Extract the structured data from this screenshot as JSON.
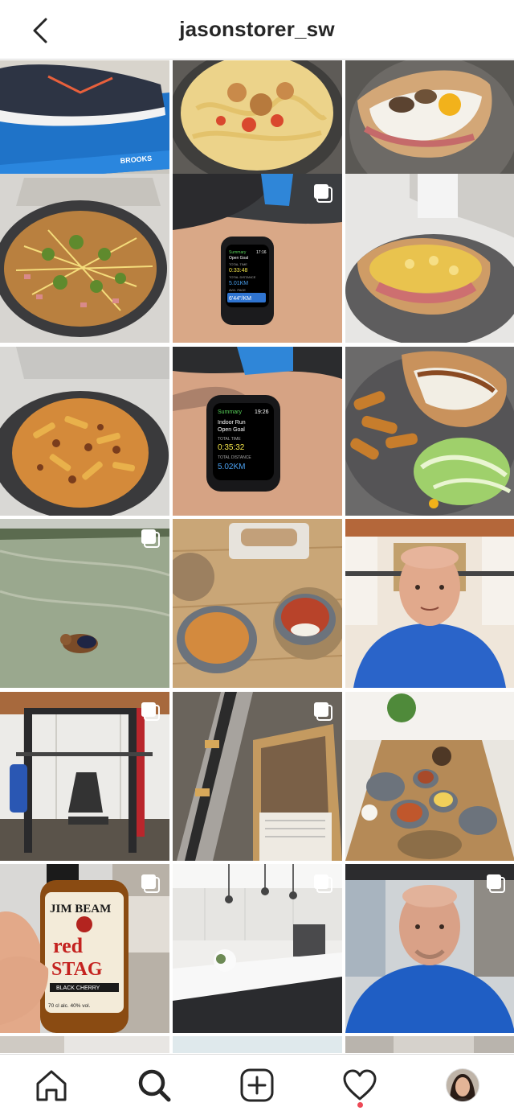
{
  "header": {
    "username": "jasonstorer_sw",
    "back_icon": "chevron-left-icon"
  },
  "grid": {
    "posts": [
      {
        "id": "shoes",
        "subject": "running shoes on box",
        "box_text": "BROOKS",
        "multi": false
      },
      {
        "id": "pasta-chicken",
        "subject": "tagliatelle with chicken",
        "multi": false
      },
      {
        "id": "pitta-mushroom",
        "subject": "pitta with egg and mushrooms",
        "multi": false
      },
      {
        "id": "loaded-fries",
        "subject": "loaded wedges with jalapenos",
        "multi": false
      },
      {
        "id": "watch-summary-1",
        "subject": "smartwatch workout summary",
        "multi": true,
        "watch": {
          "line1": "Summary",
          "line2": "Open Goal",
          "time": "17:16",
          "l3": "TOTAL TIME",
          "v3": "0:33:48",
          "l4": "TOTAL DISTANCE",
          "v4": "5.01KM",
          "l5": "AVG. PACE",
          "v5": "6'44\"/KM"
        }
      },
      {
        "id": "pitta-egg",
        "subject": "pitta with scrambled egg and bacon",
        "multi": false
      },
      {
        "id": "penne-bolognese",
        "subject": "penne bolognese",
        "multi": false
      },
      {
        "id": "watch-summary-2",
        "subject": "smartwatch indoor run",
        "multi": false,
        "watch": {
          "line1": "Summary",
          "time": "19:26",
          "line2": "Indoor Run",
          "line3": "Open Goal",
          "l4": "TOTAL TIME",
          "v4": "0:35:32",
          "l5": "TOTAL DISTANCE",
          "v5": "5.02KM"
        }
      },
      {
        "id": "pitta-wedges",
        "subject": "pitta with wedges and salad",
        "multi": false
      },
      {
        "id": "dog-field",
        "subject": "small dog on frosty field",
        "multi": true
      },
      {
        "id": "curry-table",
        "subject": "curry bowls on table",
        "multi": false
      },
      {
        "id": "selfie-1",
        "subject": "man in blue hoodie selfie",
        "multi": false
      },
      {
        "id": "home-gym",
        "subject": "home gym power rack",
        "multi": true
      },
      {
        "id": "equipment-boxes",
        "subject": "boxes with gym equipment",
        "multi": true
      },
      {
        "id": "dining-table",
        "subject": "dining table with dishes",
        "multi": false
      },
      {
        "id": "bourbon",
        "subject": "bottle of bourbon",
        "multi": true,
        "label": {
          "l1": "JIM BEAM",
          "l2": "red",
          "l3": "STAG",
          "l4": "BLACK CHERRY",
          "l5": "70 cl  alc. 40% vol."
        }
      },
      {
        "id": "kitchen",
        "subject": "white kitchen with island",
        "multi": true
      },
      {
        "id": "selfie-2",
        "subject": "man in blue t-shirt selfie",
        "multi": true
      }
    ]
  },
  "bottom_nav": {
    "items": [
      {
        "name": "home",
        "icon": "home-icon"
      },
      {
        "name": "search",
        "icon": "search-icon",
        "active": true
      },
      {
        "name": "new-post",
        "icon": "plus-square-icon"
      },
      {
        "name": "activity",
        "icon": "heart-icon",
        "has_notification": true
      },
      {
        "name": "profile",
        "icon": "avatar-icon"
      }
    ]
  },
  "colors": {
    "text": "#262626",
    "divider": "#dbdbdb",
    "notification": "#ed4956"
  }
}
